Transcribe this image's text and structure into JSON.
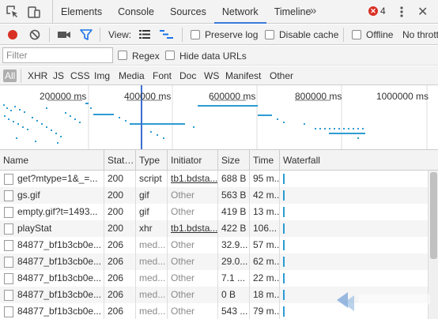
{
  "tabs": [
    {
      "label": "Elements",
      "active": false
    },
    {
      "label": "Console",
      "active": false
    },
    {
      "label": "Sources",
      "active": false
    },
    {
      "label": "Network",
      "active": true
    },
    {
      "label": "Timeline",
      "active": false
    }
  ],
  "more_tabs_glyph": "»",
  "error_count": "4",
  "toolbar": {
    "view_label": "View:",
    "preserve_log": "Preserve log",
    "disable_cache": "Disable cache",
    "offline": "Offline",
    "throttle": "No throttling"
  },
  "filter": {
    "placeholder": "Filter",
    "regex": "Regex",
    "hide_data_urls": "Hide data URLs"
  },
  "types": [
    "All",
    "XHR",
    "JS",
    "CSS",
    "Img",
    "Media",
    "Font",
    "Doc",
    "WS",
    "Manifest",
    "Other"
  ],
  "active_type": "All",
  "overview": {
    "tick_labels": [
      "200000 ms",
      "400000 ms",
      "600000 ms",
      "800000 ms",
      "1000000 ms"
    ]
  },
  "columns": [
    "Name",
    "Stat…",
    "Type",
    "Initiator",
    "Size",
    "Time",
    "Waterfall"
  ],
  "rows": [
    {
      "name": "get?mtype=1&_=...",
      "status": "200",
      "type": "script",
      "initiator": "tb1.bdsta...",
      "initiator_link": true,
      "size": "688 B",
      "time": "95 m..."
    },
    {
      "name": "gs.gif",
      "status": "200",
      "type": "gif",
      "initiator": "Other",
      "initiator_link": false,
      "size": "563 B",
      "time": "42 m..."
    },
    {
      "name": "empty.gif?t=1493...",
      "status": "200",
      "type": "gif",
      "initiator": "Other",
      "initiator_link": false,
      "size": "419 B",
      "time": "13 m..."
    },
    {
      "name": "playStat",
      "status": "200",
      "type": "xhr",
      "initiator": "tb1.bdsta...",
      "initiator_link": true,
      "size": "422 B",
      "time": "106..."
    },
    {
      "name": "84877_bf1b3cb0e...",
      "status": "206",
      "type": "med...",
      "initiator": "Other",
      "initiator_link": false,
      "size": "32.9...",
      "time": "57 m..."
    },
    {
      "name": "84877_bf1b3cb0e...",
      "status": "206",
      "type": "med...",
      "initiator": "Other",
      "initiator_link": false,
      "size": "29.0...",
      "time": "62 m..."
    },
    {
      "name": "84877_bf1b3cb0e...",
      "status": "206",
      "type": "med...",
      "initiator": "Other",
      "initiator_link": false,
      "size": "7.1 ...",
      "time": "22 m..."
    },
    {
      "name": "84877_bf1b3cb0e...",
      "status": "206",
      "type": "med...",
      "initiator": "Other",
      "initiator_link": false,
      "size": "0 B",
      "time": "18 m..."
    },
    {
      "name": "84877_bf1b3cb0e...",
      "status": "206",
      "type": "med...",
      "initiator": "Other",
      "initiator_link": false,
      "size": "543 ...",
      "time": "79 m..."
    }
  ],
  "colors": {
    "record": "#d93025",
    "filter_active": "#1a73e8",
    "waterfall": "#2d9bd3",
    "tab_underline": "#3879d9"
  }
}
